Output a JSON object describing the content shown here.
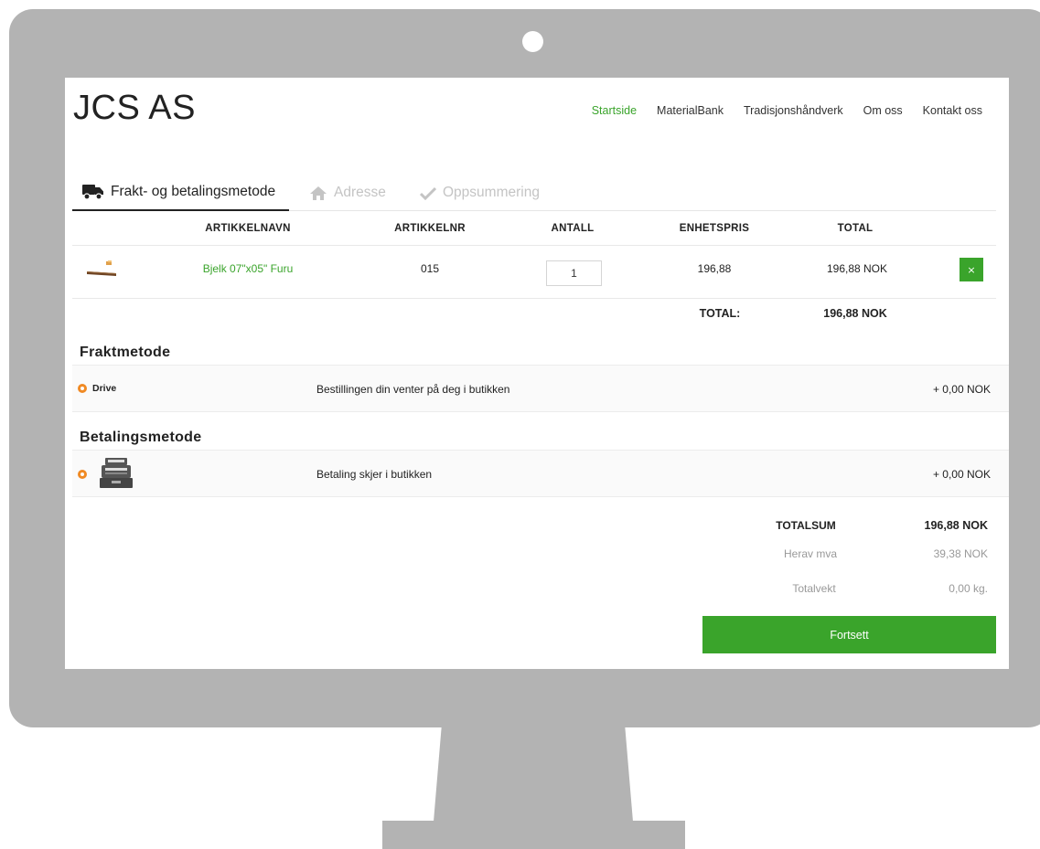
{
  "brand": {
    "logo": "JCS AS"
  },
  "nav": {
    "items": [
      "Startside",
      "MaterialBank",
      "Tradisjonshåndverk",
      "Om oss",
      "Kontakt oss"
    ],
    "active": "Startside"
  },
  "steps": [
    {
      "label": "Frakt- og betalingsmetode",
      "icon": "truck-icon",
      "active": true
    },
    {
      "label": "Adresse",
      "icon": "home-icon",
      "active": false
    },
    {
      "label": "Oppsummering",
      "icon": "checkmark-icon",
      "active": false
    }
  ],
  "cart": {
    "headers": [
      "ARTIKKELNAVN",
      "ARTIKKELNR",
      "ANTALL",
      "ENHETSPRIS",
      "TOTAL"
    ],
    "items": [
      {
        "name": "Bjelk 07\"x05\" Furu",
        "article_no": "015",
        "quantity": "1",
        "unit_price": "196,88",
        "total": "196,88 NOK",
        "remove_label": "×"
      }
    ],
    "total_label": "TOTAL:",
    "total_value": "196,88 NOK"
  },
  "shipping": {
    "title": "Fraktmetode",
    "option": {
      "name": "Drive",
      "description": "Bestillingen din venter på deg i butikken",
      "price": "+ 0,00 NOK"
    }
  },
  "payment": {
    "title": "Betalingsmetode",
    "option": {
      "icon": "cash-register-icon",
      "description": "Betaling skjer i butikken",
      "price": "+ 0,00 NOK"
    }
  },
  "summary": {
    "totalsum_label": "TOTALSUM",
    "totalsum_value": "196,88 NOK",
    "vat_label": "Herav mva",
    "vat_value": "39,38 NOK",
    "weight_label": "Totalvekt",
    "weight_value": "0,00 kg."
  },
  "continue_label": "Fortsett",
  "colors": {
    "accent": "#3aa42b",
    "radio": "#f08a24",
    "frame": "#b3b3b3"
  }
}
